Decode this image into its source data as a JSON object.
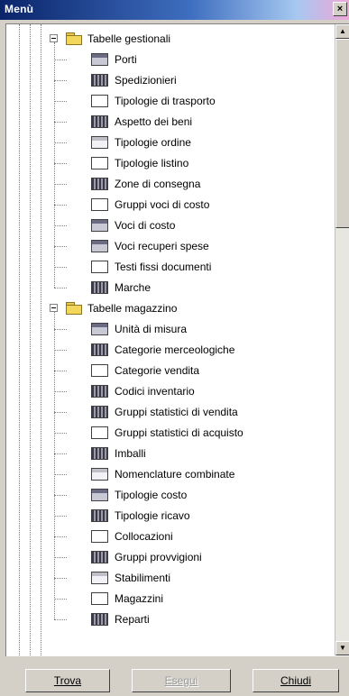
{
  "window": {
    "title": "Menù",
    "close_label": "×"
  },
  "tree": {
    "groups": [
      {
        "label": "Tabelle gestionali",
        "items": [
          {
            "label": "Porti",
            "icon": "table-form-icon"
          },
          {
            "label": "Spedizionieri",
            "icon": "table-grid-icon"
          },
          {
            "label": "Tipologie di trasporto",
            "icon": "blank-form-icon"
          },
          {
            "label": "Aspetto dei beni",
            "icon": "table-grid-icon"
          },
          {
            "label": "Tipologie ordine",
            "icon": "light-form-icon"
          },
          {
            "label": "Tipologie listino",
            "icon": "blank-form-icon"
          },
          {
            "label": "Zone di consegna",
            "icon": "table-grid-icon"
          },
          {
            "label": "Gruppi voci di costo",
            "icon": "blank-form-icon"
          },
          {
            "label": "Voci di costo",
            "icon": "table-form-icon"
          },
          {
            "label": "Voci recuperi spese",
            "icon": "table-form-icon"
          },
          {
            "label": "Testi fissi documenti",
            "icon": "blank-form-icon"
          },
          {
            "label": "Marche",
            "icon": "table-grid-icon"
          }
        ]
      },
      {
        "label": "Tabelle magazzino",
        "items": [
          {
            "label": "Unità di misura",
            "icon": "table-form-icon"
          },
          {
            "label": "Categorie merceologiche",
            "icon": "table-grid-icon"
          },
          {
            "label": "Categorie vendita",
            "icon": "blank-form-icon"
          },
          {
            "label": "Codici inventario",
            "icon": "table-grid-icon"
          },
          {
            "label": "Gruppi statistici di vendita",
            "icon": "table-grid-icon"
          },
          {
            "label": "Gruppi statistici di acquisto",
            "icon": "blank-form-icon"
          },
          {
            "label": "Imballi",
            "icon": "table-grid-icon"
          },
          {
            "label": "Nomenclature combinate",
            "icon": "light-form-icon"
          },
          {
            "label": "Tipologie costo",
            "icon": "table-form-icon"
          },
          {
            "label": "Tipologie ricavo",
            "icon": "table-grid-icon"
          },
          {
            "label": "Collocazioni",
            "icon": "blank-form-icon"
          },
          {
            "label": "Gruppi provvigioni",
            "icon": "table-grid-icon"
          },
          {
            "label": "Stabilimenti",
            "icon": "light-form-icon"
          },
          {
            "label": "Magazzini",
            "icon": "blank-form-icon"
          },
          {
            "label": "Reparti",
            "icon": "table-grid-icon"
          }
        ]
      }
    ]
  },
  "scrollbar": {
    "up_arrow": "▲",
    "down_arrow": "▼"
  },
  "buttons": {
    "find": {
      "label": "Trova"
    },
    "run": {
      "label": "Esegui"
    },
    "close": {
      "label": "Chiudi"
    }
  }
}
